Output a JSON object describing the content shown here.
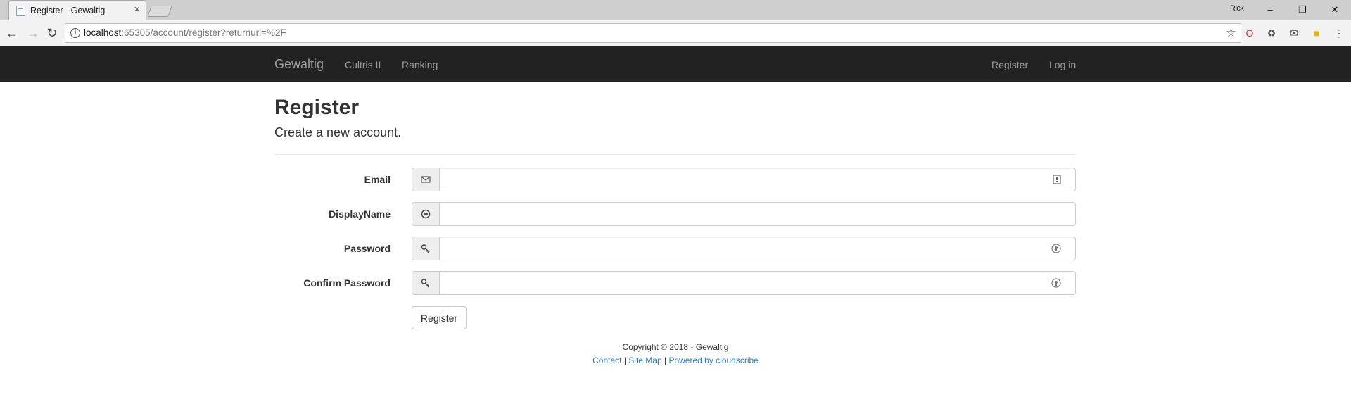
{
  "browser": {
    "tab_title": "Register - Gewaltig",
    "tab_close": "×",
    "user_name": "Rick",
    "window_controls": {
      "minimize": "–",
      "restore": "❐",
      "close": "✕"
    },
    "nav": {
      "back": "←",
      "forward": "→",
      "reload": "↻"
    },
    "url_host": "localhost",
    "url_rest": ":65305/account/register?returnurl=%2F",
    "star": "☆",
    "extensions": [
      {
        "name": "opera-extension-icon",
        "glyph": "O",
        "color": "#e0262d"
      },
      {
        "name": "recycle-extension-icon",
        "glyph": "♻",
        "color": "#555555"
      },
      {
        "name": "mail-extension-icon",
        "glyph": "✉",
        "color": "#555555"
      },
      {
        "name": "notes-extension-icon",
        "glyph": "■",
        "color": "#e8b400"
      },
      {
        "name": "menu-icon",
        "glyph": "⋮",
        "color": "#444444"
      }
    ]
  },
  "navbar": {
    "brand": "Gewaltig",
    "left_links": [
      "Cultris II",
      "Ranking"
    ],
    "right_links": [
      "Register",
      "Log in"
    ]
  },
  "main": {
    "title": "Register",
    "subtitle": "Create a new account.",
    "fields": [
      {
        "label": "Email",
        "icon": "envelope-icon",
        "value": ""
      },
      {
        "label": "DisplayName",
        "icon": "user-circle-icon",
        "value": ""
      },
      {
        "label": "Password",
        "icon": "key-icon",
        "value": ""
      },
      {
        "label": "Confirm Password",
        "icon": "key-icon",
        "value": ""
      }
    ],
    "submit_label": "Register"
  },
  "footer": {
    "copyright": "Copyright © 2018 - Gewaltig",
    "links": [
      "Contact",
      "Site Map",
      "Powered by cloudscribe"
    ],
    "separator": " | "
  }
}
